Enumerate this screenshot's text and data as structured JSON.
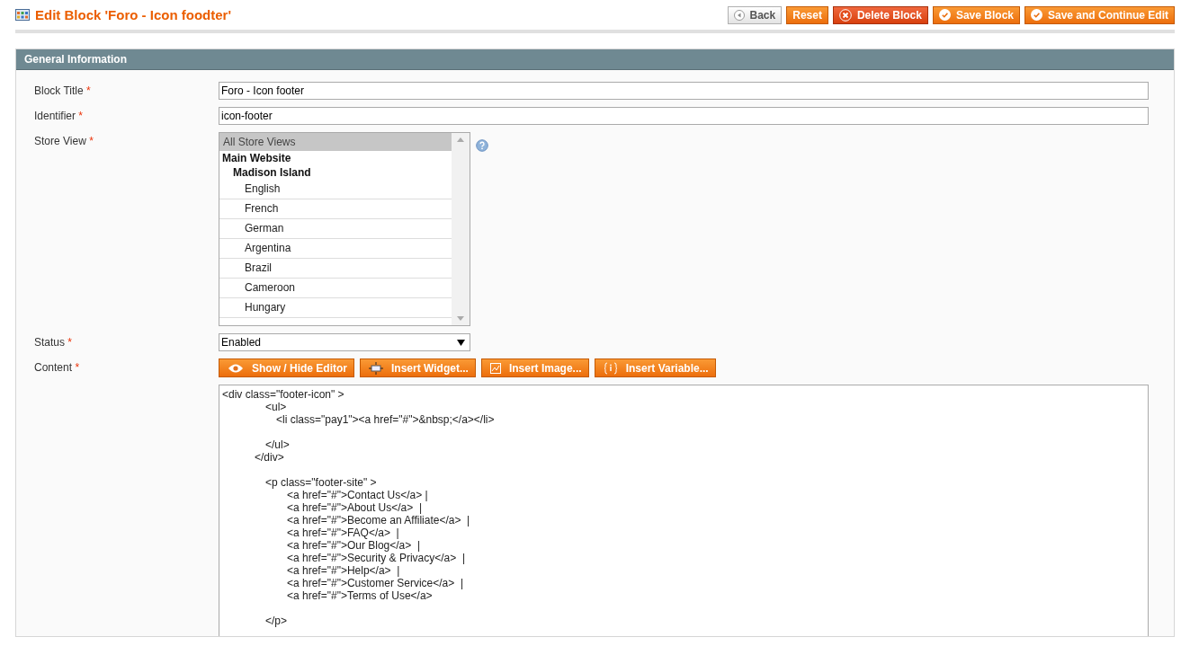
{
  "page": {
    "title": "Edit Block 'Foro - Icon foodter'"
  },
  "actions": [
    {
      "label": "Back",
      "kind": "back"
    },
    {
      "label": "Reset",
      "kind": "plain"
    },
    {
      "label": "Delete Block",
      "kind": "delete"
    },
    {
      "label": "Save Block",
      "kind": "save"
    },
    {
      "label": "Save and Continue Edit",
      "kind": "save"
    }
  ],
  "section": {
    "title": "General Information"
  },
  "fields": [
    {
      "label": "Block Title",
      "required": "*",
      "kind": "text",
      "value": "Foro - Icon footer"
    },
    {
      "label": "Identifier",
      "required": "*",
      "kind": "text",
      "value": "icon-footer"
    },
    {
      "label": "Store View",
      "required": "*",
      "kind": "multiselect",
      "options": [
        {
          "label": "All Store Views",
          "kind": "option",
          "selected": true
        },
        {
          "label": "Main Website",
          "kind": "group",
          "children": [
            {
              "label": "Madison Island",
              "kind": "group",
              "children": [
                {
                  "label": "English",
                  "kind": "option",
                  "selected": false
                },
                {
                  "label": "French",
                  "kind": "option",
                  "selected": false
                },
                {
                  "label": "German",
                  "kind": "option",
                  "selected": false
                },
                {
                  "label": "Argentina",
                  "kind": "option",
                  "selected": false
                },
                {
                  "label": "Brazil",
                  "kind": "option",
                  "selected": false
                },
                {
                  "label": "Cameroon",
                  "kind": "option",
                  "selected": false
                },
                {
                  "label": "Hungary",
                  "kind": "option",
                  "selected": false
                }
              ]
            }
          ]
        }
      ]
    },
    {
      "label": "Status",
      "required": "*",
      "kind": "select",
      "value": "Enabled"
    },
    {
      "label": "Content",
      "required": "*",
      "kind": "editor",
      "buttons": [
        {
          "label": "Show / Hide Editor",
          "kind": "eye"
        },
        {
          "label": "Insert Widget...",
          "kind": "widget"
        },
        {
          "label": "Insert Image...",
          "kind": "image"
        },
        {
          "label": "Insert Variable...",
          "kind": "variable"
        }
      ],
      "value": "<div class=\"footer-icon\" >\n\t\t\t\t<ul>\n\t\t\t\t\t<li class=\"pay1\"><a href=\"#\">&nbsp;</a></li>\n\n\t\t\t\t</ul>\n\t\t\t</div>\n\n\t\t\t\t<p class=\"footer-site\" >\n\t\t\t\t\t\t<a href=\"#\">Contact Us</a> |\n\t\t\t\t\t\t<a href=\"#\">About Us</a>  |\n\t\t\t\t\t\t<a href=\"#\">Become an Affiliate</a>  |\n\t\t\t\t\t\t<a href=\"#\">FAQ</a>  |\n\t\t\t\t\t\t<a href=\"#\">Our Blog</a>  |\n\t\t\t\t\t\t<a href=\"#\">Security & Privacy</a>  |\n\t\t\t\t\t\t<a href=\"#\">Help</a>  |\n\t\t\t\t\t\t<a href=\"#\">Customer Service</a>  |\n\t\t\t\t\t\t<a href=\"#\">Terms of Use</a>\n\n\t\t\t\t</p>"
    }
  ]
}
